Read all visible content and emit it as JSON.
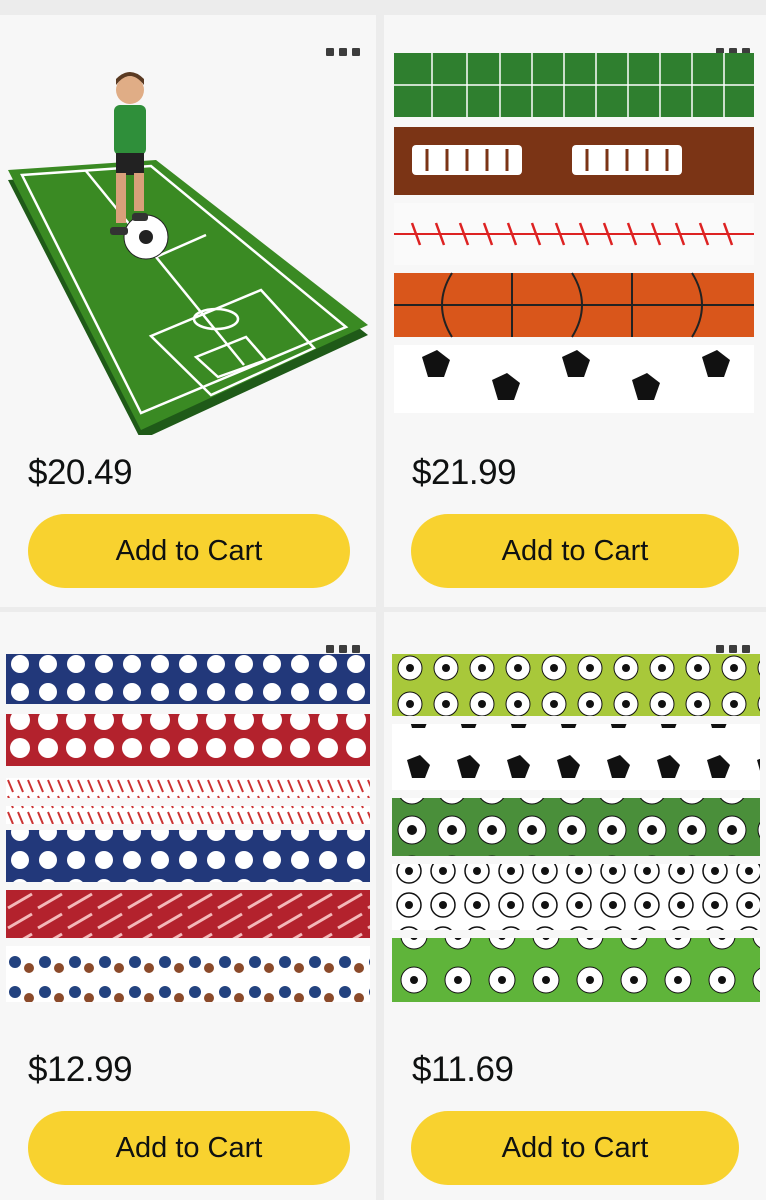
{
  "products": [
    {
      "price": "$20.49",
      "button_label": "Add to Cart",
      "image_name": "soccer-field-rug"
    },
    {
      "price": "$21.99",
      "button_label": "Add to Cart",
      "image_name": "sports-border-rolls"
    },
    {
      "price": "$12.99",
      "button_label": "Add to Cart",
      "image_name": "baseball-border-strips"
    },
    {
      "price": "$11.69",
      "button_label": "Add to Cart",
      "image_name": "soccer-border-strips"
    }
  ],
  "icons": {
    "more": "more-options-icon"
  },
  "colors": {
    "button": "#f8d22f",
    "card": "#f7f7f7",
    "background": "#ececec"
  }
}
